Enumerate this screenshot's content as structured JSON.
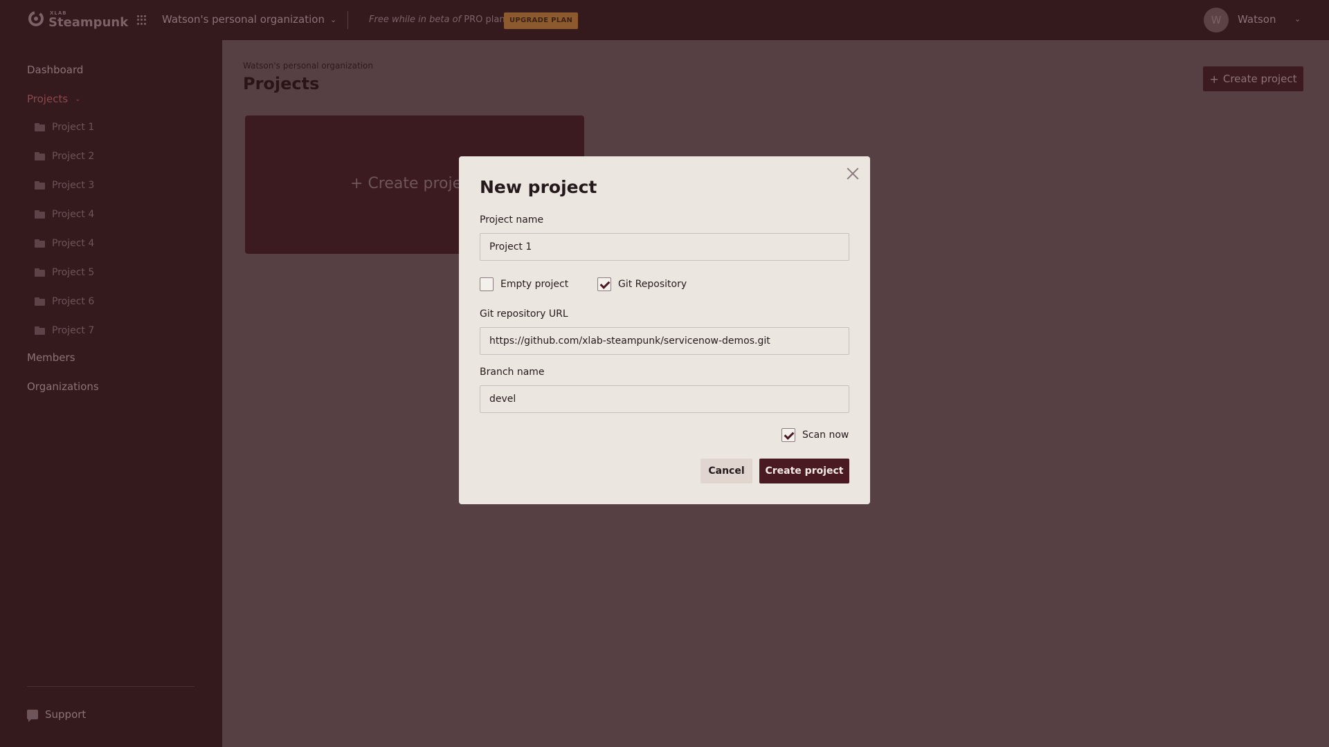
{
  "header": {
    "logo_small": "XLAB",
    "logo_text": "Steampunk",
    "org_name": "Watson's personal organization",
    "plan_note_italic": "Free while in beta of ",
    "plan_note_plain": "PRO plan",
    "upgrade_label": "UPGRADE PLAN",
    "user_initial": "W",
    "user_name": "Watson"
  },
  "sidebar": {
    "dashboard": "Dashboard",
    "projects": "Projects",
    "project_items": [
      "Project 1",
      "Project 2",
      "Project 3",
      "Project 4",
      "Project 4",
      "Project 5",
      "Project 6",
      "Project 7"
    ],
    "members": "Members",
    "organizations": "Organizations",
    "support": "Support"
  },
  "main": {
    "breadcrumb": "Watson's personal organization",
    "title": "Projects",
    "create_button": "Create project",
    "create_card_label": "Create project"
  },
  "modal": {
    "title": "New project",
    "project_name_label": "Project name",
    "project_name_value": "Project 1",
    "empty_project_label": "Empty project",
    "empty_project_checked": false,
    "git_repo_label": "Git Repository",
    "git_repo_checked": true,
    "git_url_label": "Git repository URL",
    "git_url_value": "https://github.com/xlab-steampunk/servicenow-demos.git",
    "branch_label": "Branch name",
    "branch_value": "devel",
    "scan_now_label": "Scan now",
    "scan_now_checked": true,
    "cancel_label": "Cancel",
    "create_label": "Create project"
  },
  "colors": {
    "topbar": "#34191d",
    "overlay": "#574043",
    "accent": "#4a1a22",
    "upgrade": "#8c5a2e"
  }
}
